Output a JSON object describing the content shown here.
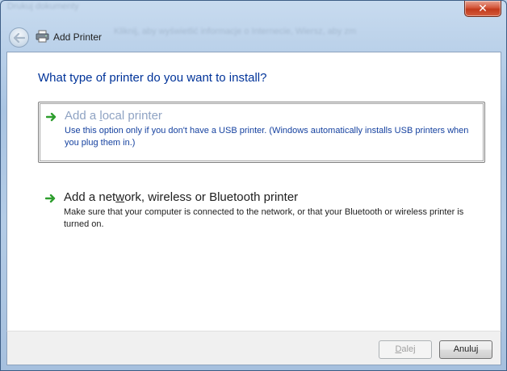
{
  "window": {
    "title": "Add Printer",
    "blurred_caption": "Drukuj dokumenty",
    "blurred_address": "Kliknij, aby wyświetlić informacje o Internecie, Wiersz, aby zmienić..."
  },
  "wizard": {
    "heading": "What type of printer do you want to install?",
    "options": [
      {
        "title_pre": "Add a ",
        "title_accel": "l",
        "title_post": "ocal printer",
        "description": "Use this option only if you don't have a USB printer. (Windows automatically installs USB printers when you plug them in.)",
        "state": "disabled-selected"
      },
      {
        "title_pre": "Add a net",
        "title_accel": "w",
        "title_post": "ork, wireless or Bluetooth printer",
        "description": "Make sure that your computer is connected to the network, or that your Bluetooth or wireless printer is turned on.",
        "state": "enabled"
      }
    ]
  },
  "footer": {
    "next_accel": "D",
    "next_rest": "alej",
    "cancel_label": "Anuluj"
  },
  "colors": {
    "heading": "#003399",
    "link_disabled": "#8fa3c3",
    "arrow_green": "#2e9e2e"
  },
  "icons": {
    "back": "back-arrow-icon",
    "printer": "printer-icon",
    "option_arrow": "green-arrow-icon",
    "close": "close-icon"
  }
}
